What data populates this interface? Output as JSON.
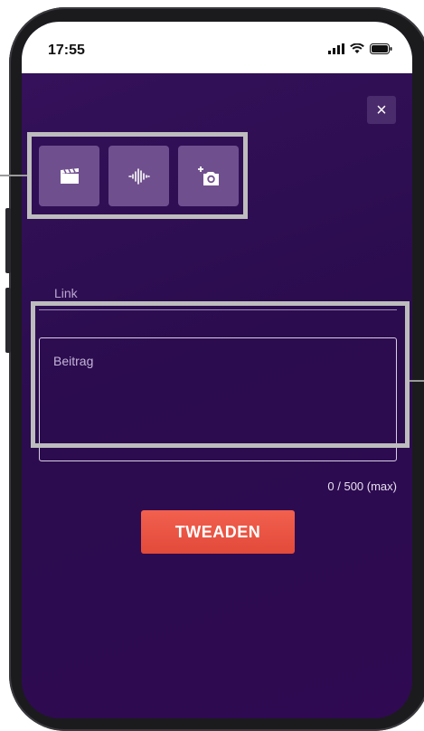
{
  "status_bar": {
    "time": "17:55",
    "icons": [
      "signal-icon",
      "wifi-icon",
      "battery-icon"
    ]
  },
  "dialog": {
    "close_label": "×",
    "media_buttons": [
      {
        "icon": "video-icon"
      },
      {
        "icon": "audio-icon"
      },
      {
        "icon": "add-photo-icon"
      }
    ],
    "link_placeholder": "Link",
    "post_placeholder": "Beitrag",
    "char_counter": "0 / 500 (max)",
    "submit_label": "TWEADEN"
  },
  "colors": {
    "background": "#2d0b50",
    "accent": "#e8503f",
    "media_button": "#6f4f8e",
    "highlight": "#bdbdbd"
  }
}
